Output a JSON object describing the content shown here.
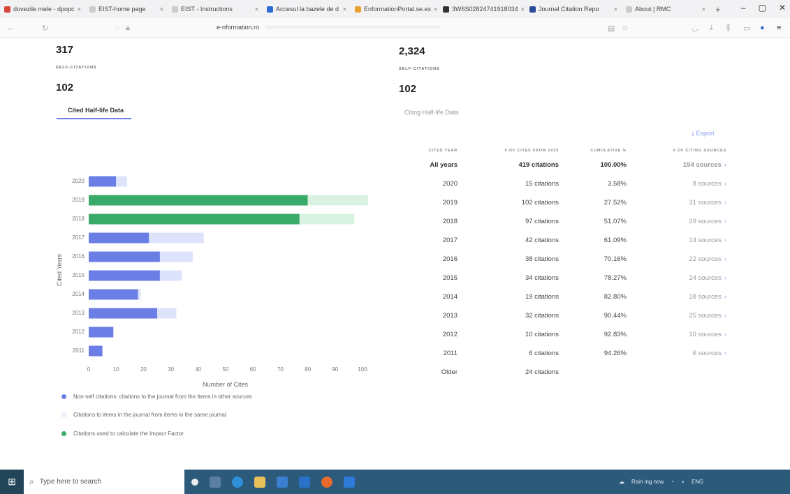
{
  "browser": {
    "tabs": [
      {
        "label": "dovezile mele - dpopc",
        "color": "#d44638"
      },
      {
        "label": "EIST-home page",
        "color": "#cccccc"
      },
      {
        "label": "EIST - Instructions",
        "color": "#cccccc"
      },
      {
        "label": "Accesul la bazele de d",
        "color": "#2b6cd4"
      },
      {
        "label": "EnformationPortal.se.ex",
        "color": "#e8a030"
      },
      {
        "label": "3W6S02824741918034",
        "color": "#333333"
      },
      {
        "label": "Journal Citation Repo",
        "color": "#2a4a9a"
      },
      {
        "label": "About | RMC",
        "color": "#cccccc"
      }
    ],
    "url": "e-nformation.ro",
    "win_min": "–",
    "win_max": "▢",
    "win_close": "✕",
    "close_glyph": "×",
    "new_tab": "+"
  },
  "summary": {
    "left_total": "317",
    "left_self_label": "SELF-CITATIONS",
    "left_self_value": "102",
    "right_total": "2,324",
    "right_self_label": "SELF-CITATIONS",
    "right_self_value": "102"
  },
  "subtabs": {
    "cited": "Cited Half-life Data",
    "citing": "Citing Half-life Data"
  },
  "export_label": "Export",
  "chart_data": {
    "type": "bar",
    "orientation": "horizontal",
    "categories": [
      "2020",
      "2019",
      "2018",
      "2017",
      "2016",
      "2015",
      "2014",
      "2013",
      "2012",
      "2011"
    ],
    "series": [
      {
        "name": "Non-self citations: citations to the journal from the items in other sources",
        "values": [
          10,
          80,
          77,
          22,
          26,
          26,
          18,
          25,
          9,
          5
        ],
        "color": "#6a7ee6"
      },
      {
        "name": "Citations used to calculate the Impact Factor",
        "values": [
          0,
          80,
          77,
          0,
          0,
          0,
          0,
          0,
          0,
          0
        ],
        "color": "#3aaa6a"
      },
      {
        "name": "Citations to items in the journal from items in the same journal",
        "values": [
          4,
          22,
          20,
          20,
          12,
          8,
          1,
          7,
          0,
          0
        ],
        "color": "#dde3fb"
      }
    ],
    "xlabel": "Number of Cites",
    "ylabel": "Cited Years",
    "xticks": [
      "0",
      "10",
      "20",
      "30",
      "40",
      "50",
      "60",
      "70",
      "80",
      "90",
      "100"
    ],
    "xlim": [
      0,
      100
    ]
  },
  "legend": [
    {
      "label": "Non-self citations: citations to the journal from the items in other sources",
      "color": "#6a7ee6"
    },
    {
      "label": "Citations to items in the journal from items in the same journal",
      "color": "#e8ecfb"
    },
    {
      "label": "Citations used to calculate the Impact Factor",
      "color": "#3aaa6a"
    }
  ],
  "table": {
    "headers": [
      "CITED YEAR",
      "# OF CITES FROM 2020",
      "CUMULATIVE %",
      "# OF CITING SOURCES"
    ],
    "rows": [
      {
        "year": "All years",
        "cites": "419 citations",
        "cum": "100.00%",
        "sources": "154 sources",
        "bold": true
      },
      {
        "year": "2020",
        "cites": "15 citations",
        "cum": "3.58%",
        "sources": "8 sources"
      },
      {
        "year": "2019",
        "cites": "102 citations",
        "cum": "27.52%",
        "sources": "31 sources"
      },
      {
        "year": "2018",
        "cites": "97 citations",
        "cum": "51.07%",
        "sources": "29 sources"
      },
      {
        "year": "2017",
        "cites": "42 citations",
        "cum": "61.09%",
        "sources": "14 sources"
      },
      {
        "year": "2016",
        "cites": "38 citations",
        "cum": "70.16%",
        "sources": "22 sources"
      },
      {
        "year": "2015",
        "cites": "34 citations",
        "cum": "78.27%",
        "sources": "24 sources"
      },
      {
        "year": "2014",
        "cites": "19 citations",
        "cum": "82.80%",
        "sources": "18 sources"
      },
      {
        "year": "2013",
        "cites": "32 citations",
        "cum": "90.44%",
        "sources": "25 sources"
      },
      {
        "year": "2012",
        "cites": "10 citations",
        "cum": "92.83%",
        "sources": "10 sources"
      },
      {
        "year": "2011",
        "cites": "6 citations",
        "cum": "94.26%",
        "sources": "6 sources"
      },
      {
        "year": "Older",
        "cites": "24 citations",
        "cum": "",
        "sources": ""
      }
    ]
  },
  "taskbar": {
    "search_placeholder": "Type here to search",
    "tray_text": "Rain ing now",
    "lang": "ENG",
    "start_icon": "⊞",
    "search_icon": "⌕"
  }
}
